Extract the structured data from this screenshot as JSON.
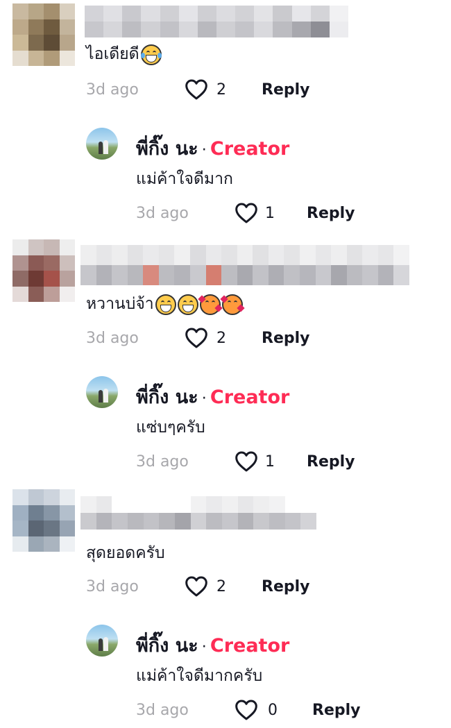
{
  "accent_color": "#fe2c55",
  "comments": [
    {
      "text": "ไอเดียดี",
      "emojis": [
        "face-with-tears-of-joy"
      ],
      "time": "3d ago",
      "likes": "2",
      "reply_label": "Reply",
      "reply": {
        "author": "พี่กิ๊ง นะ",
        "separator": "·",
        "badge": "Creator",
        "text": "แม่ค้าใจดีมาก",
        "time": "3d ago",
        "likes": "1",
        "reply_label": "Reply"
      }
    },
    {
      "text": "หวานบ่จ้า",
      "emojis": [
        "grinning-face",
        "grinning-face",
        "smiling-face-with-hearts",
        "smiling-face-with-hearts"
      ],
      "time": "3d ago",
      "likes": "2",
      "reply_label": "Reply",
      "reply": {
        "author": "พี่กิ๊ง นะ",
        "separator": "·",
        "badge": "Creator",
        "text": "แซ่บๆครับ",
        "time": "3d ago",
        "likes": "1",
        "reply_label": "Reply"
      }
    },
    {
      "text": "สุดยอดครับ",
      "emojis": [],
      "time": "3d ago",
      "likes": "2",
      "reply_label": "Reply",
      "reply": {
        "author": "พี่กิ๊ง นะ",
        "separator": "·",
        "badge": "Creator",
        "text": "แม่ค้าใจดีมากครับ",
        "time": "3d ago",
        "likes": "0",
        "reply_label": "Reply"
      }
    }
  ]
}
